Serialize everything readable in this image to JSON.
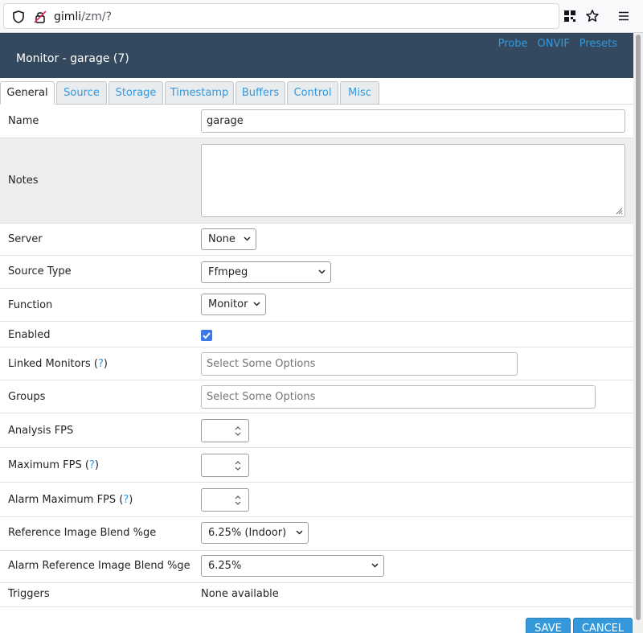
{
  "browser": {
    "url_host": "gimli",
    "url_path": "/zm/?"
  },
  "header": {
    "title": "Monitor - garage (7)",
    "links": [
      "Probe",
      "ONVIF",
      "Presets"
    ]
  },
  "tabs": [
    "General",
    "Source",
    "Storage",
    "Timestamp",
    "Buffers",
    "Control",
    "Misc"
  ],
  "active_tab": "General",
  "form": {
    "name": {
      "label": "Name",
      "value": "garage"
    },
    "notes": {
      "label": "Notes",
      "value": ""
    },
    "server": {
      "label": "Server",
      "value": "None"
    },
    "source_type": {
      "label": "Source Type",
      "value": "Ffmpeg"
    },
    "function": {
      "label": "Function",
      "value": "Monitor"
    },
    "enabled": {
      "label": "Enabled",
      "checked": true
    },
    "linked_monitors": {
      "label": "Linked Monitors (",
      "help": "?",
      "suffix": ")",
      "placeholder": "Select Some Options"
    },
    "groups": {
      "label": "Groups",
      "placeholder": "Select Some Options"
    },
    "analysis_fps": {
      "label": "Analysis FPS",
      "value": ""
    },
    "maximum_fps": {
      "label": "Maximum FPS (",
      "help": "?",
      "suffix": ")",
      "value": ""
    },
    "alarm_maximum_fps": {
      "label": "Alarm Maximum FPS (",
      "help": "?",
      "suffix": ")",
      "value": ""
    },
    "ref_blend": {
      "label": "Reference Image Blend %ge",
      "value": "6.25% (Indoor)"
    },
    "alarm_ref_blend": {
      "label": "Alarm Reference Image Blend %ge",
      "value": "6.25%"
    },
    "triggers": {
      "label": "Triggers",
      "value": "None available"
    }
  },
  "buttons": {
    "save": "SAVE",
    "cancel": "CANCEL"
  },
  "colors": {
    "header_bg": "#34495e",
    "link": "#3498db",
    "button": "#3498db"
  }
}
